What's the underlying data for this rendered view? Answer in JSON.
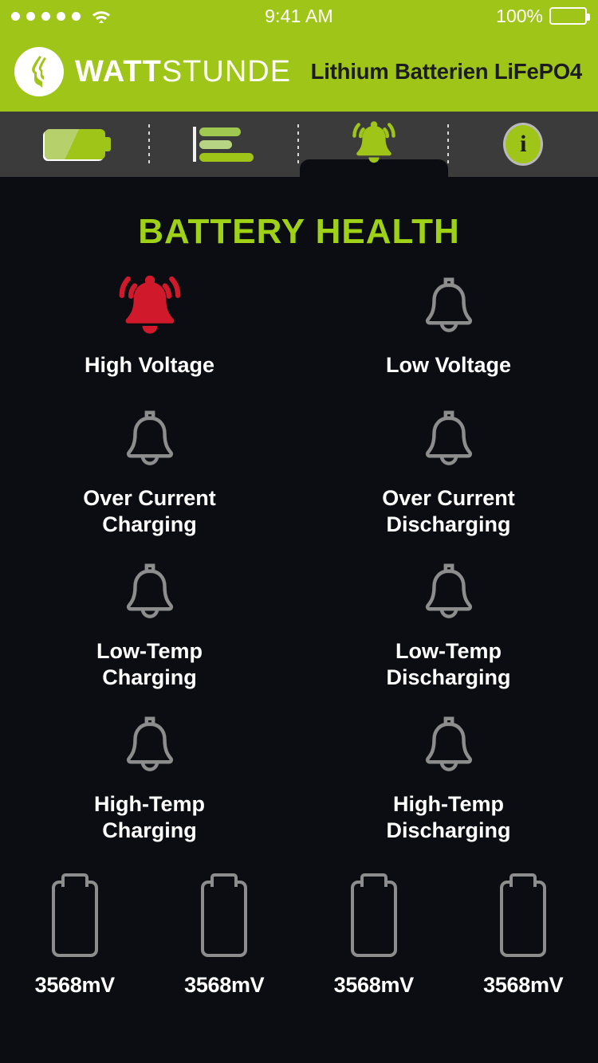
{
  "status_bar": {
    "signal_dots": 5,
    "wifi_icon": "wifi-icon",
    "time": "9:41 AM",
    "battery_percent": "100%",
    "battery_icon": "battery-full-icon"
  },
  "header": {
    "logo_icon": "wattstunde-logo-icon",
    "brand_bold": "WATT",
    "brand_light": "STUNDE",
    "title": "Lithium Batterien LiFePO4",
    "accent_color": "#9fc519"
  },
  "tabs": [
    {
      "name": "tab-battery",
      "icon": "battery-icon",
      "active": false
    },
    {
      "name": "tab-stats",
      "icon": "bar-chart-icon",
      "active": false
    },
    {
      "name": "tab-alarms",
      "icon": "bell-ring-icon",
      "active": true
    },
    {
      "name": "tab-info",
      "icon": "info-icon",
      "active": false,
      "glyph": "i"
    }
  ],
  "main": {
    "page_title": "BATTERY HEALTH",
    "title_color": "#9fd117",
    "alarm_active_color": "#d0192b",
    "alarm_inactive_color": "#8d8d8d",
    "alarms": [
      {
        "label": "High Voltage",
        "icon": "bell-ring-icon",
        "state": "active"
      },
      {
        "label": "Low Voltage",
        "icon": "bell-icon",
        "state": "inactive"
      },
      {
        "label": "Over Current\nCharging",
        "icon": "bell-icon",
        "state": "inactive"
      },
      {
        "label": "Over Current\nDischarging",
        "icon": "bell-icon",
        "state": "inactive"
      },
      {
        "label": "Low-Temp\nCharging",
        "icon": "bell-icon",
        "state": "inactive"
      },
      {
        "label": "Low-Temp\nDischarging",
        "icon": "bell-icon",
        "state": "inactive"
      },
      {
        "label": "High-Temp\nCharging",
        "icon": "bell-icon",
        "state": "inactive"
      },
      {
        "label": "High-Temp\nDischarging",
        "icon": "bell-icon",
        "state": "inactive"
      }
    ],
    "cells": [
      {
        "icon": "battery-cell-icon",
        "voltage": "3568mV"
      },
      {
        "icon": "battery-cell-icon",
        "voltage": "3568mV"
      },
      {
        "icon": "battery-cell-icon",
        "voltage": "3568mV"
      },
      {
        "icon": "battery-cell-icon",
        "voltage": "3568mV"
      }
    ]
  }
}
